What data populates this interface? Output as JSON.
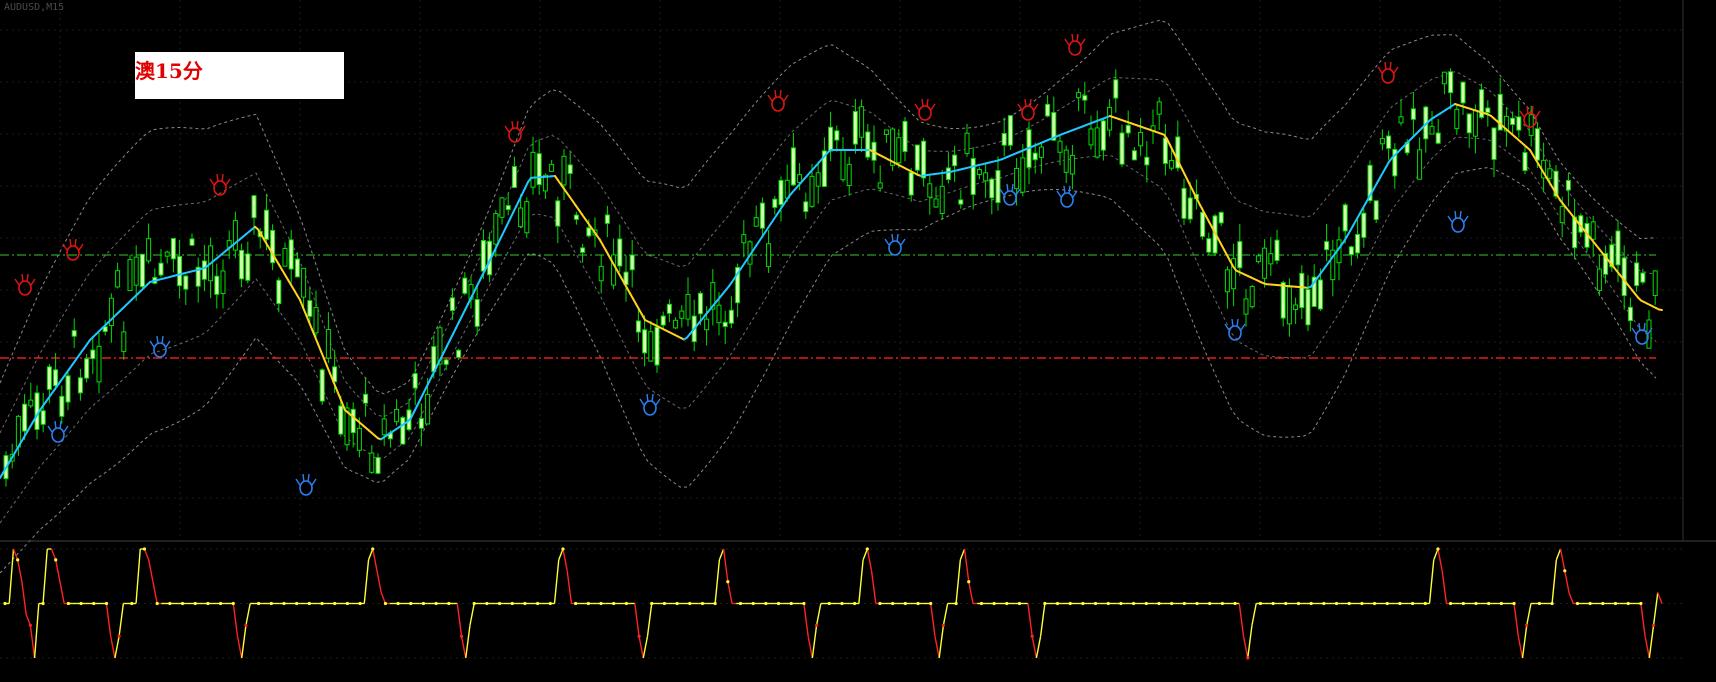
{
  "symbol_info": "AUDUSD,M15",
  "overlay_label": "澳15分",
  "indicator_title": "",
  "colors": {
    "background": "#000000",
    "candle_up": "#00dd00",
    "candle_down": "#d8ffb0",
    "ma_up": "#1ec8ff",
    "ma_down": "#ffd21e",
    "band": "#8a8a8a",
    "level_green": "#32c832",
    "level_red": "#e01e1e",
    "fractal_up": "#e01414",
    "fractal_down": "#2c7ff0",
    "osc_up": "#ffff33",
    "osc_down": "#ff2222"
  },
  "chart_data": [
    {
      "type": "candlestick",
      "title": "",
      "overlays": [
        "moving-average",
        "bollinger-bands",
        "fractals",
        "horizontal-levels"
      ],
      "y_ticks_visible": false,
      "grid": true,
      "icons": [
        "fractal-up-hand-icon",
        "fractal-down-hand-icon"
      ]
    },
    {
      "type": "line",
      "title": "",
      "levels": [
        100,
        50,
        0
      ],
      "markers": true,
      "series": [
        {
          "values": [
            50,
            50,
            100,
            90,
            70,
            40,
            30,
            0,
            50,
            50,
            100,
            100,
            90,
            70,
            50,
            50,
            50,
            50,
            50,
            50,
            50,
            50,
            50,
            50,
            50,
            20,
            0,
            20,
            50,
            50,
            50,
            50,
            100,
            100,
            90,
            70,
            50,
            50,
            50,
            50,
            50,
            50,
            50,
            50,
            50,
            50,
            50,
            50,
            50,
            50,
            50,
            50,
            50,
            50,
            50,
            20,
            0,
            30,
            50,
            50,
            50,
            50,
            50,
            50,
            50,
            50,
            50,
            50,
            50,
            50,
            50,
            50,
            50,
            50,
            50,
            50,
            50,
            50,
            50,
            50,
            50,
            50,
            50,
            50,
            50,
            50,
            90,
            100,
            80,
            60,
            50,
            50,
            50,
            50,
            50,
            50,
            50,
            50,
            50,
            50,
            50,
            50,
            50,
            50,
            50,
            50,
            50,
            50,
            20,
            0,
            30,
            50,
            50,
            50,
            50,
            50,
            50,
            50,
            50,
            50,
            50,
            50,
            50,
            50,
            50,
            50,
            50,
            50,
            50,
            50,
            50,
            90,
            100,
            80,
            50,
            50,
            50,
            50,
            50,
            50,
            50,
            50,
            50,
            50,
            50,
            50,
            50,
            50,
            50,
            50,
            20,
            0,
            20,
            50,
            50,
            50,
            50,
            50,
            50,
            50,
            50,
            50,
            50,
            50,
            50,
            50,
            50,
            50,
            50,
            90,
            100,
            70,
            50,
            50,
            50,
            50,
            50,
            50,
            50,
            50,
            50,
            50,
            50,
            50,
            50,
            50,
            50,
            50,
            50,
            50,
            20,
            0,
            30,
            50,
            50,
            50,
            50,
            50,
            50,
            50,
            50,
            50,
            50,
            90,
            100,
            80,
            50,
            50,
            50,
            50,
            50,
            50,
            50,
            50,
            50,
            50,
            50,
            50,
            50,
            50,
            20,
            0,
            30,
            50,
            50,
            50,
            90,
            100,
            70,
            50,
            50,
            50,
            50,
            50,
            50,
            50,
            50,
            50,
            50,
            50,
            50,
            50,
            50,
            20,
            0,
            20,
            50,
            50,
            50,
            50,
            50,
            50,
            50,
            50,
            50,
            50,
            50,
            50,
            50,
            50,
            50,
            50,
            50,
            50,
            50,
            50,
            50,
            50,
            50,
            50,
            50,
            50,
            50,
            50,
            50,
            50,
            50,
            50,
            50,
            50,
            50,
            50,
            50,
            50,
            50,
            50,
            50,
            50,
            50,
            50,
            50,
            50,
            50,
            20,
            0,
            30,
            50,
            50,
            50,
            50,
            50,
            50,
            50,
            50,
            50,
            50,
            50,
            50,
            50,
            50,
            50,
            50,
            50,
            50,
            50,
            50,
            50,
            50,
            50,
            50,
            50,
            50,
            50,
            50,
            50,
            50,
            50,
            50,
            50,
            50,
            50,
            50,
            50,
            50,
            50,
            50,
            50,
            50,
            90,
            100,
            80,
            50,
            50,
            50,
            50,
            50,
            50,
            50,
            50,
            50,
            50,
            50,
            50,
            50,
            50,
            50,
            50,
            50,
            20,
            0,
            30,
            50,
            50,
            50,
            50,
            50,
            50,
            90,
            100,
            80,
            60,
            50,
            50,
            50,
            50,
            50,
            50,
            50,
            50,
            50,
            50,
            50,
            50,
            50,
            50,
            50,
            50,
            50,
            20,
            0,
            30,
            60,
            50
          ]
        }
      ]
    }
  ]
}
